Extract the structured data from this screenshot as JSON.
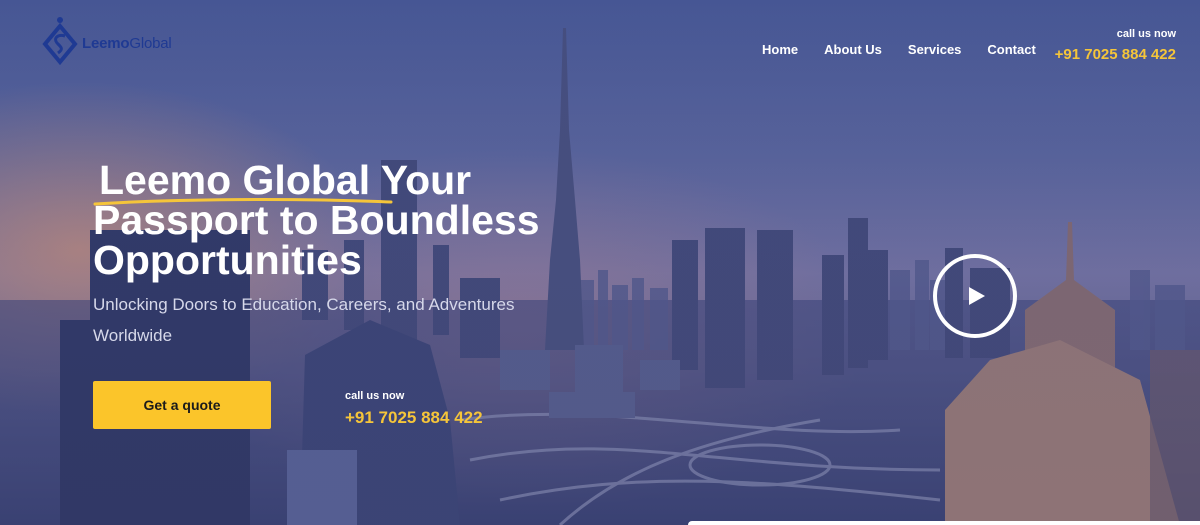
{
  "brand": {
    "name_bold": "Leemo",
    "name_regular": "Global",
    "logo_icon": "diamond-s-logo-icon",
    "color": "#1f3a93"
  },
  "nav": {
    "items": [
      {
        "label": "Home"
      },
      {
        "label": "About Us"
      },
      {
        "label": "Services"
      },
      {
        "label": "Contact"
      }
    ]
  },
  "header_call": {
    "label": "call us now",
    "number": "+91 7025 884 422"
  },
  "hero": {
    "title_highlight": "Leemo Global",
    "title_rest_1": " Your",
    "title_line_2": "Passport to Boundless",
    "title_line_3": "Opportunities",
    "subtitle": "Unlocking Doors to Education, Careers, and Adventures Worldwide",
    "cta_label": "Get a quote",
    "call_label": "call us now",
    "call_number": "+91 7025 884 422",
    "play_icon": "play-icon"
  },
  "colors": {
    "accent": "#fbc52a",
    "phone": "#f5c53a",
    "underline": "#f5c53a"
  }
}
